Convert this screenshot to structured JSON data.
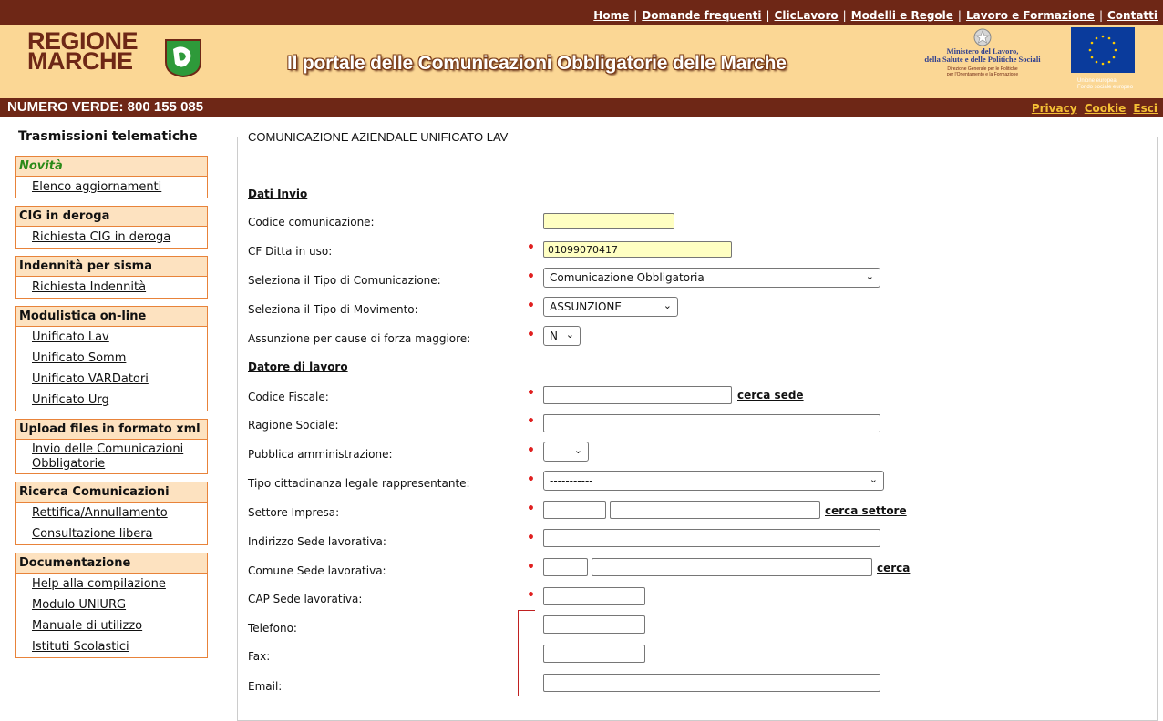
{
  "top_nav": [
    "Home",
    "Domande frequenti",
    "ClicLavoro",
    "Modelli e Regole",
    "Lavoro e Formazione",
    "Contatti"
  ],
  "logo": {
    "line1": "REGIONE",
    "line2": "MARCHE"
  },
  "portal_title": "Il portale delle Comunicazioni Obbligatorie delle Marche",
  "ministero": {
    "line1": "Ministero del Lavoro,",
    "line2": "della Salute e delle Politiche Sociali",
    "sub1": "Direzione Generale per le Politiche",
    "sub2": "per l'Orientamento e la Formazione"
  },
  "eu": {
    "sub1": "Unione europea",
    "sub2": "Fondo sociale europeo"
  },
  "numero_verde": "NUMERO VERDE: 800 155 085",
  "right_links": {
    "privacy": "Privacy",
    "cookie": "Cookie",
    "esci": "Esci"
  },
  "sidebar": {
    "title": "Trasmissioni telematiche",
    "sections": [
      {
        "head": "Novità",
        "items": [
          "Elenco aggiornamenti"
        ]
      },
      {
        "head": "CIG in deroga",
        "items": [
          "Richiesta CIG in deroga"
        ]
      },
      {
        "head": "Indennità per sisma",
        "items": [
          "Richiesta Indennità"
        ]
      },
      {
        "head": "Modulistica on-line",
        "items": [
          "Unificato Lav",
          "Unificato Somm",
          "Unificato VARDatori",
          "Unificato Urg"
        ]
      },
      {
        "head": "Upload files in formato xml",
        "items": [
          "Invio delle Comunicazioni Obbligatorie"
        ]
      },
      {
        "head": "Ricerca Comunicazioni",
        "items": [
          "Rettifica/Annullamento",
          "Consultazione libera"
        ]
      },
      {
        "head": "Documentazione",
        "items": [
          "Help alla compilazione",
          "Modulo UNIURG",
          "Manuale di utilizzo",
          "Istituti Scolastici"
        ]
      }
    ]
  },
  "form": {
    "legend": "COMUNICAZIONE AZIENDALE UNIFICATO LAV",
    "section_invio": "Dati Invio",
    "codice_comunicazione": {
      "label": "Codice comunicazione:",
      "value": ""
    },
    "cf_ditta": {
      "label": "CF Ditta in uso:",
      "value": "01099070417"
    },
    "tipo_comunicazione": {
      "label": "Seleziona il Tipo di Comunicazione:",
      "value": "Comunicazione Obbligatoria"
    },
    "tipo_movimento": {
      "label": "Seleziona il Tipo di Movimento:",
      "value": "ASSUNZIONE"
    },
    "forza_maggiore": {
      "label": "Assunzione per cause di forza maggiore:",
      "value": "N"
    },
    "section_datore": "Datore di lavoro",
    "codice_fiscale": {
      "label": "Codice Fiscale:",
      "link": "cerca sede"
    },
    "ragione_sociale": {
      "label": "Ragione Sociale:"
    },
    "pubblica_amm": {
      "label": "Pubblica amministrazione:",
      "value": "--"
    },
    "tipo_cittadinanza": {
      "label": "Tipo cittadinanza legale rappresentante:",
      "value": "-----------"
    },
    "settore_impresa": {
      "label": "Settore Impresa:",
      "link": "cerca settore"
    },
    "indirizzo_sede": {
      "label": "Indirizzo Sede lavorativa:"
    },
    "comune_sede": {
      "label": "Comune Sede lavorativa:",
      "link": "cerca"
    },
    "cap_sede": {
      "label": "CAP Sede lavorativa:"
    },
    "telefono": {
      "label": "Telefono:"
    },
    "fax": {
      "label": "Fax:"
    },
    "email": {
      "label": "Email:"
    }
  },
  "colors": {
    "brown": "#6e2716",
    "banner": "#fbd795",
    "menu_border": "#e8833a",
    "menu_head": "#fde2c0",
    "required": "#e02020"
  }
}
